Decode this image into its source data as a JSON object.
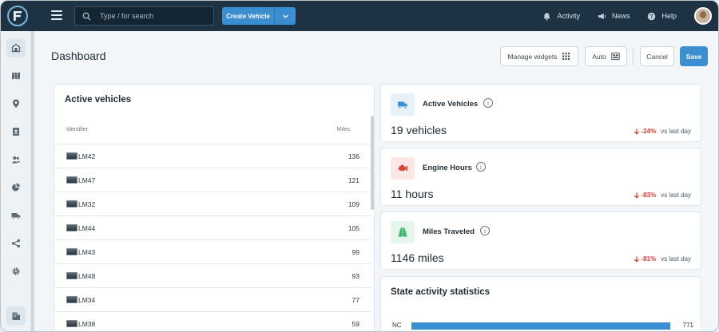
{
  "topbar": {
    "search_placeholder": "Type / for search",
    "create_label": "Create Vehicle",
    "activity_label": "Activity",
    "news_label": "News",
    "help_label": "Help"
  },
  "sidebar": {
    "items": [
      {
        "name": "home",
        "icon": "building-icon"
      },
      {
        "name": "map",
        "icon": "map-icon"
      },
      {
        "name": "locations",
        "icon": "location-pin-icon"
      },
      {
        "name": "contacts",
        "icon": "contact-book-icon"
      },
      {
        "name": "users",
        "icon": "users-icon"
      },
      {
        "name": "reports",
        "icon": "pie-chart-icon"
      },
      {
        "name": "vehicles",
        "icon": "truck-icon"
      },
      {
        "name": "share",
        "icon": "share-icon"
      },
      {
        "name": "settings",
        "icon": "gear-icon"
      },
      {
        "name": "company",
        "icon": "office-icon"
      }
    ]
  },
  "header": {
    "title": "Dashboard",
    "manage_widgets": "Manage widgets",
    "auto": "Auto",
    "cancel": "Cancel",
    "save": "Save"
  },
  "vehicles": {
    "title": "Active vehicles",
    "col_identifier": "Identifier",
    "col_miles": "Miles",
    "rows": [
      {
        "id": "LM42",
        "miles": "136"
      },
      {
        "id": "LM47",
        "miles": "121"
      },
      {
        "id": "LM32",
        "miles": "109"
      },
      {
        "id": "LM44",
        "miles": "105"
      },
      {
        "id": "LM43",
        "miles": "99"
      },
      {
        "id": "LM48",
        "miles": "93"
      },
      {
        "id": "LM34",
        "miles": "77"
      },
      {
        "id": "LM38",
        "miles": "59"
      }
    ]
  },
  "stats": [
    {
      "label": "Active Vehicles",
      "value": "19 vehicles",
      "delta": "-24%",
      "suffix": "vs last day",
      "icon": "truck-icon",
      "color": "#3b8fd0",
      "bg": "#e6f1fa"
    },
    {
      "label": "Engine Hours",
      "value": "11 hours",
      "delta": "-83%",
      "suffix": "vs last day",
      "icon": "engine-icon",
      "color": "#d9453b",
      "bg": "#fbe7e5"
    },
    {
      "label": "Miles Traveled",
      "value": "1146 miles",
      "delta": "-81%",
      "suffix": "vs last day",
      "icon": "road-icon",
      "color": "#3fb56f",
      "bg": "#e5f5ec"
    }
  ],
  "state_stats": {
    "title": "State activity statistics",
    "rows": [
      {
        "state": "NC",
        "value": "771",
        "fraction": 1.0
      }
    ]
  },
  "colors": {
    "topbar": "#1d3344",
    "accent": "#3b8fd0",
    "negative": "#d73a2f"
  }
}
